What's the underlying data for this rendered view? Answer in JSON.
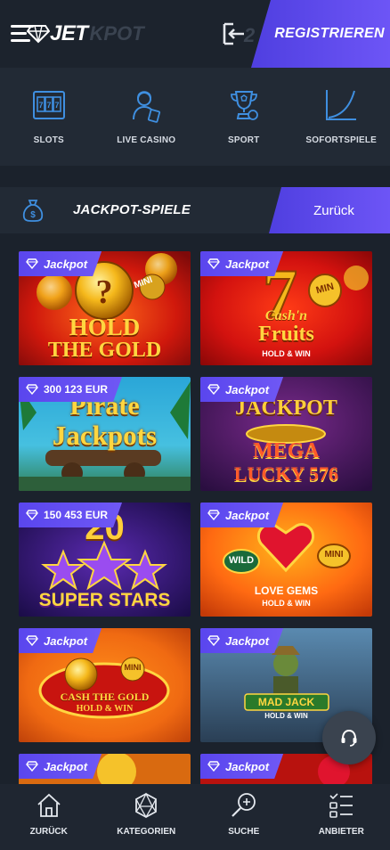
{
  "header": {
    "logo_text": "JET",
    "logo_sub": "KPOT",
    "login_counter": "2",
    "register_label": "REGISTRIEREN"
  },
  "categories": [
    {
      "label": "SLOTS",
      "icon": "slot-machine-icon"
    },
    {
      "label": "LIVE CASINO",
      "icon": "dealer-icon"
    },
    {
      "label": "SPORT",
      "icon": "trophy-icon"
    },
    {
      "label": "SOFORTSPIELE",
      "icon": "graph-icon"
    }
  ],
  "section": {
    "title": "JACKPOT-SPIELE",
    "back_label": "Zurück",
    "icon": "money-bag-icon"
  },
  "games": [
    {
      "badge": "Jackpot",
      "title_line1": "HOLD",
      "title_line2": "THE GOLD",
      "extra": "MINI"
    },
    {
      "badge": "Jackpot",
      "title_line1": "Cash'n",
      "title_line2": "Fruits",
      "extra": "HOLD & WIN",
      "extra2": "MIN"
    },
    {
      "badge": "300 123 EUR",
      "title_line1": "Pirate",
      "title_line2": "Jackpots"
    },
    {
      "badge": "Jackpot",
      "title_line1": "JACKPOT",
      "title_line2": "MEGA",
      "title_line3": "LUCKY 576"
    },
    {
      "badge": "150 453 EUR",
      "title_line1": "20",
      "title_line2": "SUPER STARS"
    },
    {
      "badge": "Jackpot",
      "title_line1": "LOVE GEMS",
      "title_line2": "HOLD & WIN",
      "extra": "WILD",
      "extra2": "MINI"
    },
    {
      "badge": "Jackpot",
      "title_line1": "CASH THE GOLD",
      "title_line2": "HOLD & WIN",
      "extra": "MINI"
    },
    {
      "badge": "Jackpot",
      "title_line1": "MAD JACK",
      "title_line2": "HOLD & WIN"
    },
    {
      "badge": "Jackpot"
    },
    {
      "badge": "Jackpot"
    }
  ],
  "bottom_nav": [
    {
      "label": "ZURÜCK",
      "icon": "home-icon"
    },
    {
      "label": "KATEGORIEN",
      "icon": "dice-icon"
    },
    {
      "label": "SUCHE",
      "icon": "search-icon"
    },
    {
      "label": "ANBIETER",
      "icon": "list-icon"
    }
  ],
  "colors": {
    "accent": "#5a46ee",
    "background": "#1b222c",
    "icon_blue": "#3f8fe0"
  }
}
